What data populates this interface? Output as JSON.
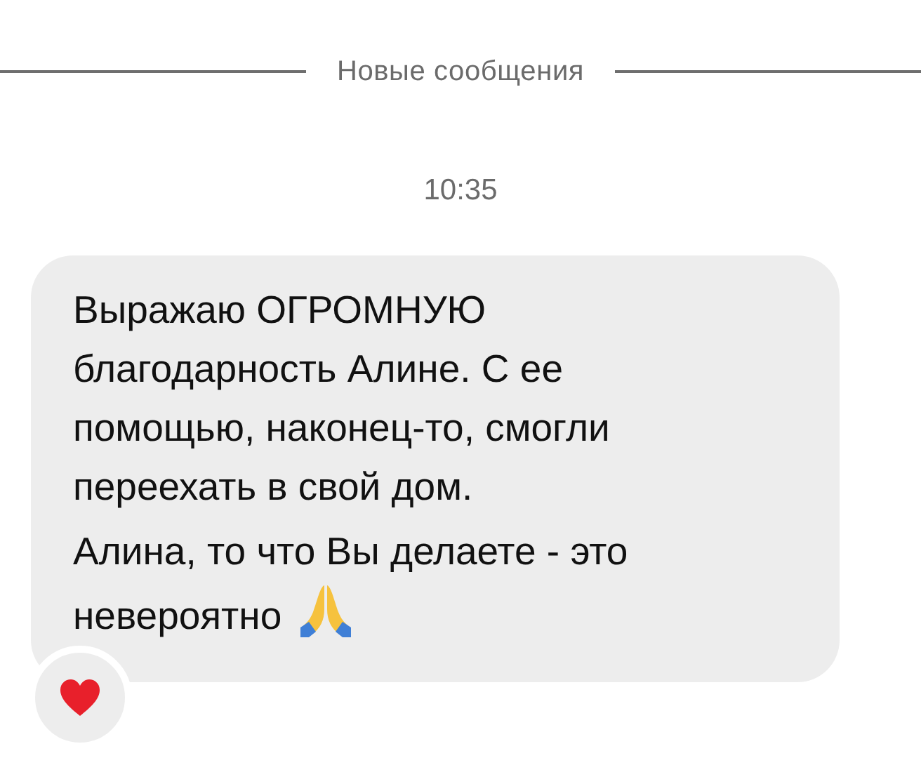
{
  "divider": {
    "label": "Новые сообщения"
  },
  "timestamp": "10:35",
  "message": {
    "paragraphs": [
      "Выражаю ОГРОМНУЮ благодарность Алине. С ее помощью, наконец-то, смогли переехать в свой дом.",
      "Алина, то что Вы делаете - это невероятно"
    ],
    "reaction": {
      "kind": "heart"
    }
  }
}
